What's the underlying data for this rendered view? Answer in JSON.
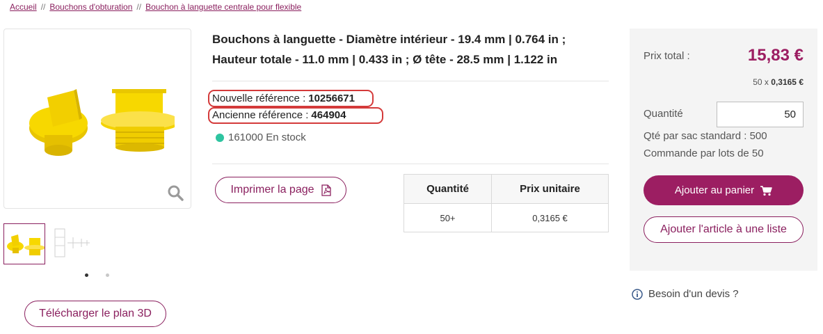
{
  "breadcrumb": {
    "home": "Accueil",
    "separator": "//",
    "category": "Bouchons d'obturation",
    "current": "Bouchon à languette centrale pour flexible"
  },
  "product": {
    "title": "Bouchons à languette - Diamètre intérieur - 19.4 mm | 0.764 in ; Hauteur totale - 11.0 mm | 0.433 in ; Ø tête - 28.5 mm | 1.122 in",
    "new_ref_label": "Nouvelle référence :",
    "new_ref_value": "10256671",
    "old_ref_label": "Ancienne référence :",
    "old_ref_value": "464904",
    "stock": "161000 En stock",
    "print_label": "Imprimer la page",
    "download_3d_label": "Télécharger le plan 3D",
    "image_icons": [
      "product-plug-image",
      "zoom-icon",
      "technical-drawing-thumbnail"
    ],
    "carousel_dots": 2,
    "active_dot": 0
  },
  "price_table": {
    "headers": [
      "Quantité",
      "Prix unitaire"
    ],
    "rows": [
      [
        "50+",
        "0,3165 €"
      ]
    ]
  },
  "sidebar": {
    "total_label": "Prix total :",
    "total_price": "15,83 €",
    "unit_prefix": "50 x",
    "unit_price": "0,3165 €",
    "qty_label": "Quantité",
    "qty_value": "50",
    "std_bag": "Qté par sac standard : 500",
    "lot": "Commande par lots de 50",
    "add_cart": "Ajouter au panier",
    "add_list": "Ajouter l'article à une liste"
  },
  "quote": "Besoin d'un devis ?",
  "colors": {
    "brand": "#9c1e62",
    "stock_dot": "#2ec4a0",
    "highlight_mark": "#d43a3a",
    "product_yellow": "#f5d400"
  }
}
